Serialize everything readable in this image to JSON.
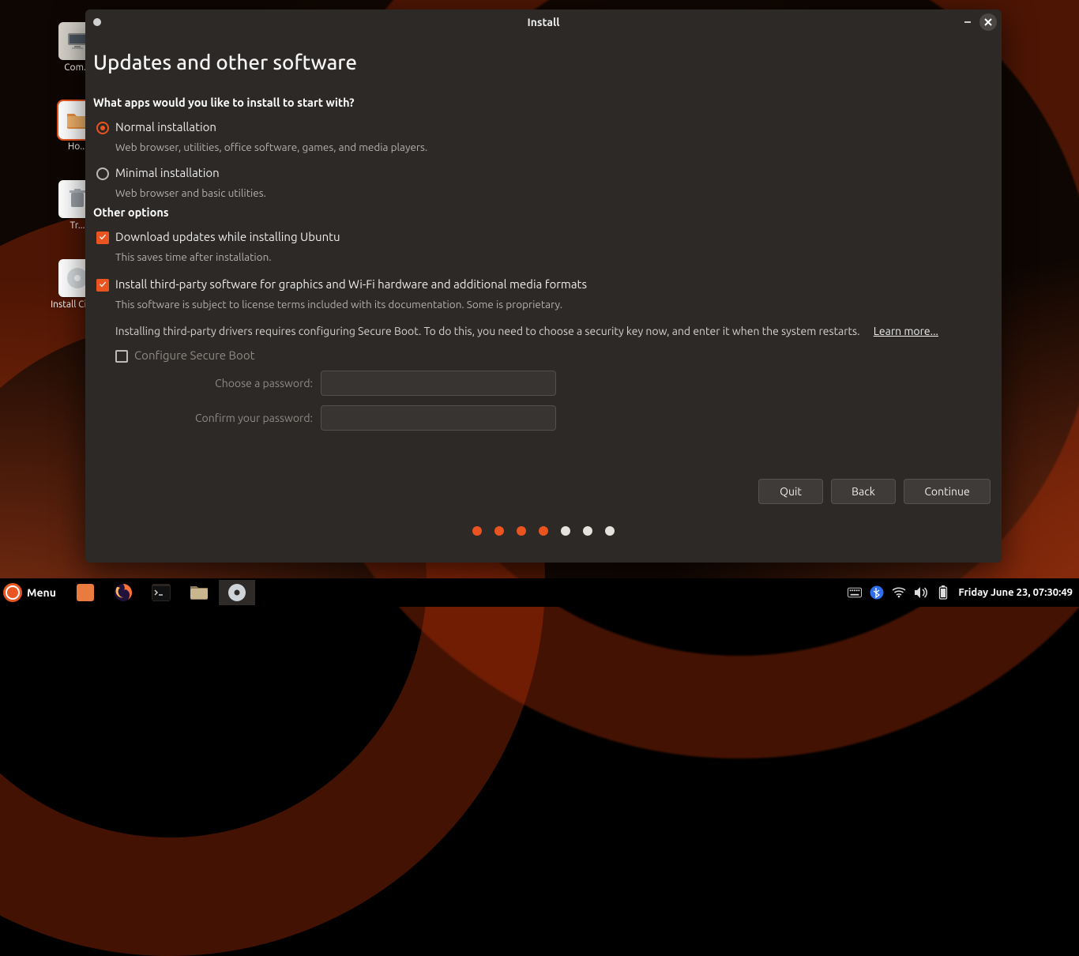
{
  "window": {
    "title": "Install"
  },
  "page": {
    "heading": "Updates and other software",
    "section1": "What apps would you like to install to start with?",
    "normal": {
      "label": "Normal installation",
      "desc": "Web browser, utilities, office software, games, and media players."
    },
    "minimal": {
      "label": "Minimal installation",
      "desc": "Web browser and basic utilities."
    },
    "section2": "Other options",
    "download": {
      "label": "Download updates while installing Ubuntu",
      "desc": "This saves time after installation."
    },
    "thirdparty": {
      "label": "Install third-party software for graphics and Wi-Fi hardware and additional media formats",
      "desc": "This software is subject to license terms included with its documentation. Some is proprietary.",
      "note": "Installing third-party drivers requires configuring Secure Boot. To do this, you need to choose a security key now, and enter it when the system restarts.",
      "learn_more": "Learn more..."
    },
    "secureboot": {
      "label": "Configure Secure Boot",
      "pass_label": "Choose a password:",
      "confirm_label": "Confirm your password:"
    }
  },
  "footer": {
    "quit": "Quit",
    "back": "Back",
    "continue": "Continue"
  },
  "progress": {
    "total": 7,
    "on": 4
  },
  "desktop": {
    "icons": [
      {
        "label": "Com..."
      },
      {
        "label": "Ho..."
      },
      {
        "label": "Tr..."
      },
      {
        "label": "Install Cinn..."
      }
    ]
  },
  "panel": {
    "menu": "Menu",
    "clock": "Friday June 23, 07:30:49"
  }
}
